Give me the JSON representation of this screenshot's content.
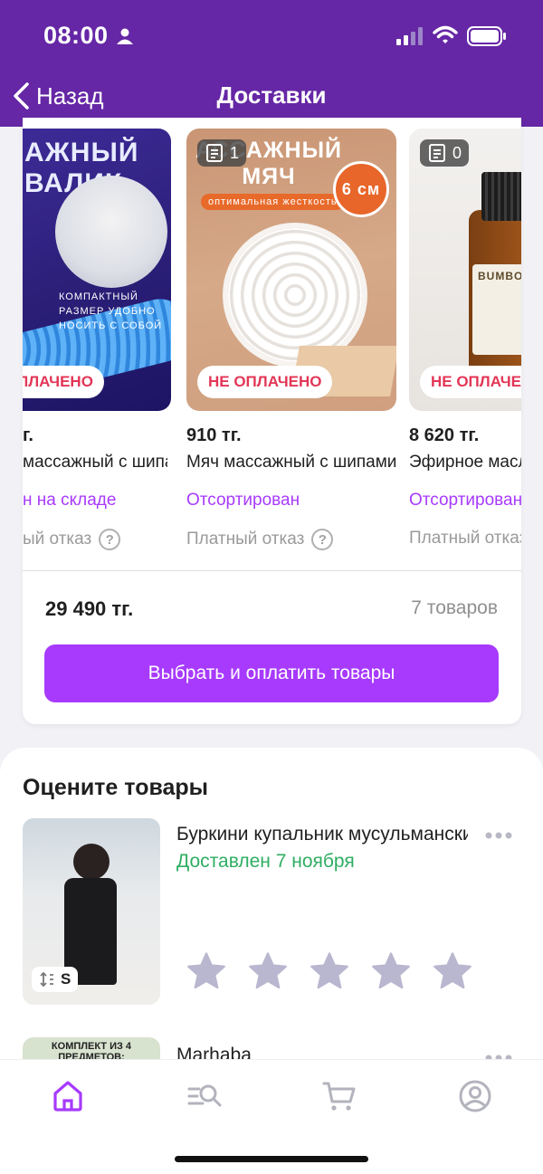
{
  "status_bar": {
    "time": "08:00"
  },
  "header": {
    "back_label": "Назад",
    "title": "Доставки"
  },
  "products": [
    {
      "image_text": "АЖНЫЙ ВАЛИК",
      "image_caption": "КОМПАКТНЫЙ РАЗМЕР УДОБНО НОСИТЬ С СОБОЙ",
      "badge": "ПЛАЧЕНО",
      "price": "г.",
      "name": "массажный с шипами",
      "status": "н на складе",
      "refuse": "ый отказ"
    },
    {
      "image_text": "АССАЖНЫЙ МЯЧ",
      "image_subtext": "оптимальная жесткость",
      "image_size": "6 см",
      "count": "1",
      "badge": "НЕ ОПЛАЧЕНО",
      "price": "910 тг.",
      "name": "Мяч массажный с шипами",
      "status": "Отсортирован",
      "refuse": "Платный отказ"
    },
    {
      "image_text": "BUMBO ЛАДАН",
      "count": "0",
      "badge": "НЕ ОПЛАЧЕНО",
      "price": "8 620 тг.",
      "name": "Эфирное масло",
      "status": "Отсортирован",
      "refuse": "Платный отказ"
    }
  ],
  "summary": {
    "total": "29 490 тг.",
    "items_count": "7 товаров",
    "pay_button": "Выбрать и оплатить товары"
  },
  "rate": {
    "title": "Оцените товары",
    "items": [
      {
        "name": "Буркини купальник мусульманский",
        "delivered": "Доставлен 7 ноября",
        "size": "S"
      },
      {
        "name": "Marhaba",
        "thumb_text": "КОМПЛЕКТ ИЗ 4 ПРЕДМЕТОВ:"
      }
    ]
  },
  "nav": [
    "home-icon",
    "search-catalog-icon",
    "cart-icon",
    "profile-icon"
  ],
  "colors": {
    "header": "#6527a5",
    "accent": "#a73afd",
    "unpaid": "#e33656",
    "delivered": "#2fae62"
  }
}
